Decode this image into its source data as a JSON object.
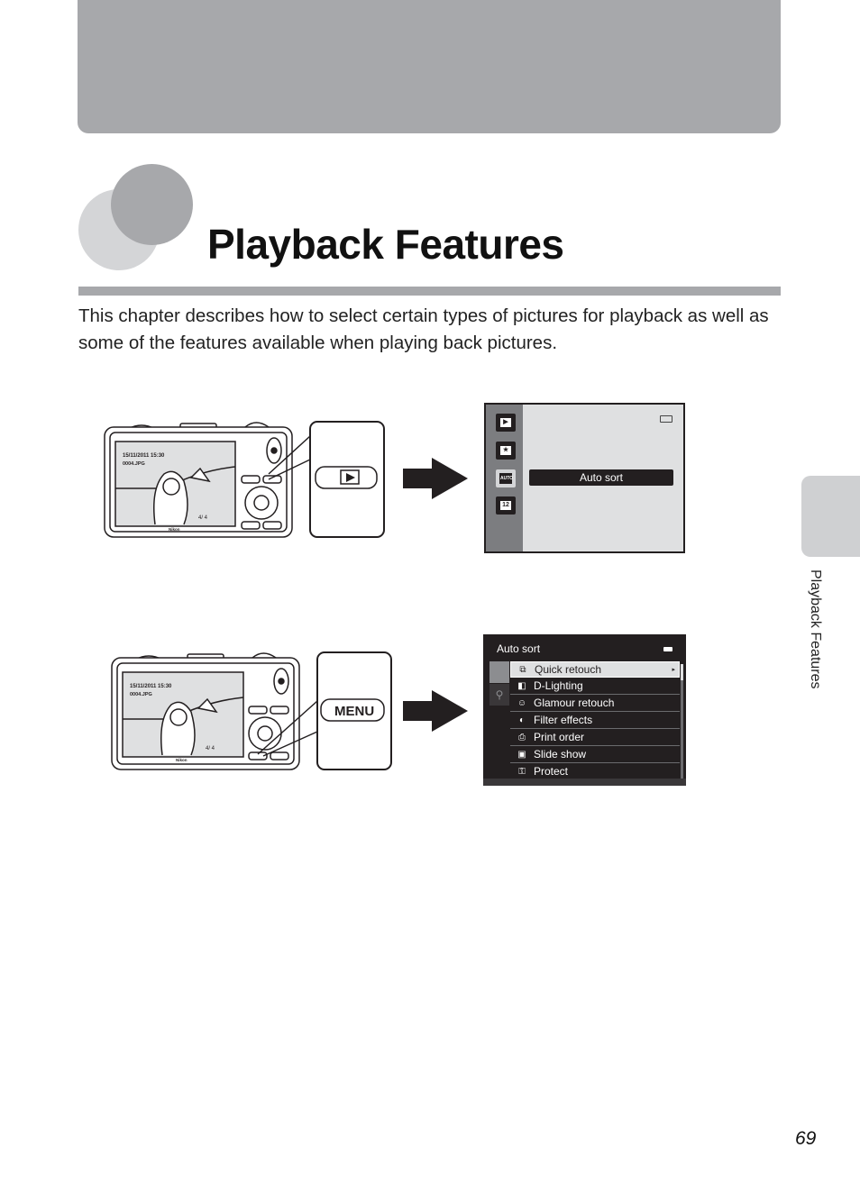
{
  "page": {
    "title": "Playback Features",
    "intro": "This chapter describes how to select certain types of pictures for playback as well as some of the features available when playing back pictures.",
    "side_label": "Playback Features",
    "page_number": "69"
  },
  "camera_1": {
    "date": "15/11/2011 15:30",
    "file": "0004.JPG",
    "counter": "4/   4",
    "brand": "Nikon",
    "callout_button": "play-button"
  },
  "camera_2": {
    "date": "15/11/2011 15:30",
    "file": "0004.JPG",
    "counter": "4/   4",
    "brand": "Nikon",
    "callout_button_label": "MENU"
  },
  "screen_1": {
    "highlight_label": "Auto sort",
    "rail_icons": [
      "playback-icon",
      "favorites-icon",
      "auto-sort-icon",
      "list-by-date-icon"
    ],
    "selected_index": 2
  },
  "screen_2": {
    "title": "Auto sort",
    "tabs": [
      "auto-sort-tab-icon",
      "setup-wrench-icon"
    ],
    "items": [
      {
        "label": "Quick retouch",
        "icon": "quick-retouch-icon",
        "glyph": "⧉",
        "selected": true
      },
      {
        "label": "D-Lighting",
        "icon": "d-lighting-icon",
        "glyph": "◧"
      },
      {
        "label": "Glamour retouch",
        "icon": "glamour-retouch-icon",
        "glyph": "☺"
      },
      {
        "label": "Filter effects",
        "icon": "filter-effects-icon",
        "glyph": "◐"
      },
      {
        "label": "Print order",
        "icon": "print-order-icon",
        "glyph": "⎙"
      },
      {
        "label": "Slide show",
        "icon": "slide-show-icon",
        "glyph": "▣"
      },
      {
        "label": "Protect",
        "icon": "protect-key-icon",
        "glyph": "⚿"
      }
    ]
  },
  "colors": {
    "band_gray": "#a7a8ab",
    "light_gray": "#d4d5d7",
    "screen_dark": "#231f20",
    "screen_light": "#dfe0e1"
  }
}
